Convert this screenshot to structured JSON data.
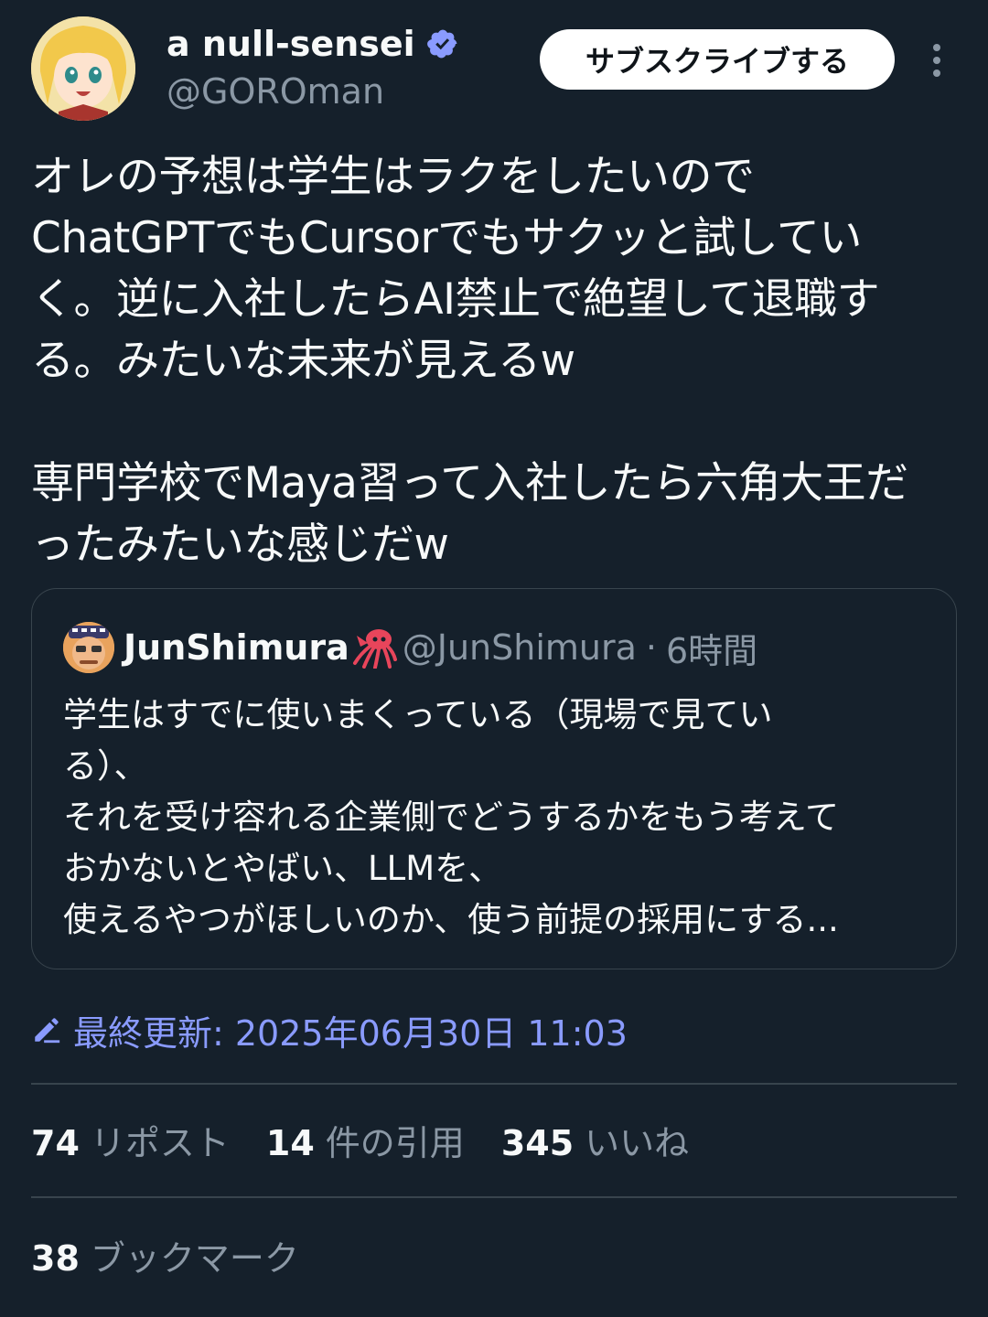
{
  "author": {
    "display_name": "a null-sensei",
    "handle": "@GOROman",
    "verified": true,
    "avatar_icon": "anime-girl-avatar"
  },
  "subscribe_label": "サブスクライブする",
  "more_icon": "more-vertical-icon",
  "tweet": {
    "text": "オレの予想は学生はラクをしたいので\nChatGPTでもCursorでもサクッと試してい\nく。逆に入社したらAI禁止で絶望して退職す\nる。みたいな未来が見えるw\n\n専門学校でMaya習って入社したら六角大王だ\nったみたいな感じだw"
  },
  "quote": {
    "display_name": "JunShimura",
    "emoji_icon": "squid-icon",
    "handle": "@JunShimura",
    "separator": "·",
    "time": "6時間",
    "text": "学生はすでに使いまくっている（現場で見てい\nる）、\nそれを受け容れる企業側でどうするかをもう考えて\nおかないとやばい、LLMを、\n使えるやつがほしいのか、使う前提の採用にする..."
  },
  "edited": {
    "label": "最終更新: 2025年06月30日 11:03"
  },
  "stats": {
    "reposts": {
      "count": "74",
      "label": "リポスト"
    },
    "quotes": {
      "count": "14",
      "label": "件の引用"
    },
    "likes": {
      "count": "345",
      "label": "いいね"
    },
    "bookmarks": {
      "count": "38",
      "label": "ブックマーク"
    }
  },
  "colors": {
    "background": "#15202b",
    "text": "#f7f9f9",
    "muted": "#8b98a5",
    "accent": "#8a9bff",
    "verified": "#1d9bf0"
  }
}
